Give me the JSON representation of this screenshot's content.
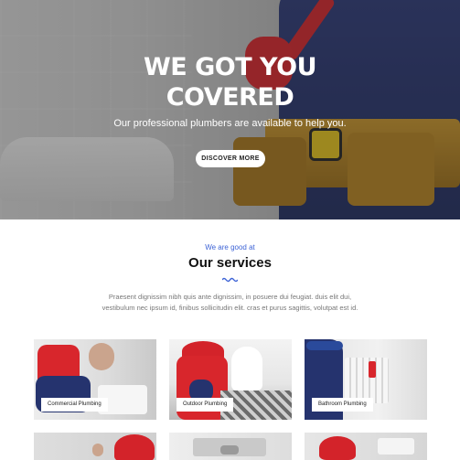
{
  "hero": {
    "title": "WE GOT YOU COVERED",
    "subtitle": "Our professional plumbers are available to help you.",
    "button_label": "DISCOVER MORE"
  },
  "services": {
    "pretitle": "We are good at",
    "title": "Our services",
    "description": "Praesent dignissim nibh quis ante dignissim, in posuere dui feugiat. duis elit dui, vestibulum nec ipsum id, finibus sollicitudin elit. cras et purus sagittis, volutpat est id.",
    "cards": [
      {
        "label": "Commercial Plumbing"
      },
      {
        "label": "Outdoor Plumbing"
      },
      {
        "label": "Bathroom Plumbing"
      },
      {
        "label": ""
      },
      {
        "label": ""
      },
      {
        "label": ""
      }
    ]
  },
  "colors": {
    "accent": "#3d63d6",
    "heading": "#111111",
    "body_text": "#777777"
  }
}
